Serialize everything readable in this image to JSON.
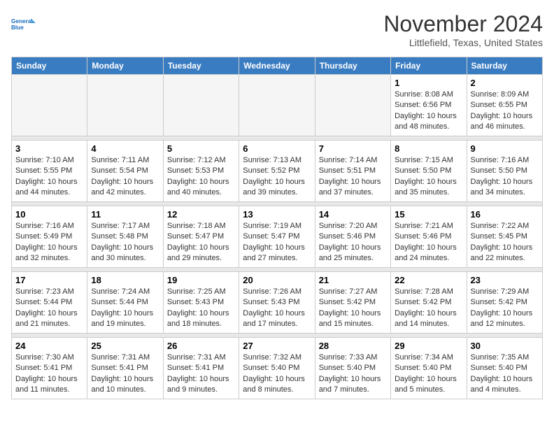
{
  "header": {
    "logo_line1": "General",
    "logo_line2": "Blue",
    "month": "November 2024",
    "location": "Littlefield, Texas, United States"
  },
  "days_of_week": [
    "Sunday",
    "Monday",
    "Tuesday",
    "Wednesday",
    "Thursday",
    "Friday",
    "Saturday"
  ],
  "weeks": [
    [
      {
        "day": "",
        "empty": true
      },
      {
        "day": "",
        "empty": true
      },
      {
        "day": "",
        "empty": true
      },
      {
        "day": "",
        "empty": true
      },
      {
        "day": "",
        "empty": true
      },
      {
        "day": "1",
        "sunrise": "8:08 AM",
        "sunset": "6:56 PM",
        "daylight": "10 hours and 48 minutes."
      },
      {
        "day": "2",
        "sunrise": "8:09 AM",
        "sunset": "6:55 PM",
        "daylight": "10 hours and 46 minutes."
      }
    ],
    [
      {
        "day": "3",
        "sunrise": "7:10 AM",
        "sunset": "5:55 PM",
        "daylight": "10 hours and 44 minutes."
      },
      {
        "day": "4",
        "sunrise": "7:11 AM",
        "sunset": "5:54 PM",
        "daylight": "10 hours and 42 minutes."
      },
      {
        "day": "5",
        "sunrise": "7:12 AM",
        "sunset": "5:53 PM",
        "daylight": "10 hours and 40 minutes."
      },
      {
        "day": "6",
        "sunrise": "7:13 AM",
        "sunset": "5:52 PM",
        "daylight": "10 hours and 39 minutes."
      },
      {
        "day": "7",
        "sunrise": "7:14 AM",
        "sunset": "5:51 PM",
        "daylight": "10 hours and 37 minutes."
      },
      {
        "day": "8",
        "sunrise": "7:15 AM",
        "sunset": "5:50 PM",
        "daylight": "10 hours and 35 minutes."
      },
      {
        "day": "9",
        "sunrise": "7:16 AM",
        "sunset": "5:50 PM",
        "daylight": "10 hours and 34 minutes."
      }
    ],
    [
      {
        "day": "10",
        "sunrise": "7:16 AM",
        "sunset": "5:49 PM",
        "daylight": "10 hours and 32 minutes."
      },
      {
        "day": "11",
        "sunrise": "7:17 AM",
        "sunset": "5:48 PM",
        "daylight": "10 hours and 30 minutes."
      },
      {
        "day": "12",
        "sunrise": "7:18 AM",
        "sunset": "5:47 PM",
        "daylight": "10 hours and 29 minutes."
      },
      {
        "day": "13",
        "sunrise": "7:19 AM",
        "sunset": "5:47 PM",
        "daylight": "10 hours and 27 minutes."
      },
      {
        "day": "14",
        "sunrise": "7:20 AM",
        "sunset": "5:46 PM",
        "daylight": "10 hours and 25 minutes."
      },
      {
        "day": "15",
        "sunrise": "7:21 AM",
        "sunset": "5:46 PM",
        "daylight": "10 hours and 24 minutes."
      },
      {
        "day": "16",
        "sunrise": "7:22 AM",
        "sunset": "5:45 PM",
        "daylight": "10 hours and 22 minutes."
      }
    ],
    [
      {
        "day": "17",
        "sunrise": "7:23 AM",
        "sunset": "5:44 PM",
        "daylight": "10 hours and 21 minutes."
      },
      {
        "day": "18",
        "sunrise": "7:24 AM",
        "sunset": "5:44 PM",
        "daylight": "10 hours and 19 minutes."
      },
      {
        "day": "19",
        "sunrise": "7:25 AM",
        "sunset": "5:43 PM",
        "daylight": "10 hours and 18 minutes."
      },
      {
        "day": "20",
        "sunrise": "7:26 AM",
        "sunset": "5:43 PM",
        "daylight": "10 hours and 17 minutes."
      },
      {
        "day": "21",
        "sunrise": "7:27 AM",
        "sunset": "5:42 PM",
        "daylight": "10 hours and 15 minutes."
      },
      {
        "day": "22",
        "sunrise": "7:28 AM",
        "sunset": "5:42 PM",
        "daylight": "10 hours and 14 minutes."
      },
      {
        "day": "23",
        "sunrise": "7:29 AM",
        "sunset": "5:42 PM",
        "daylight": "10 hours and 12 minutes."
      }
    ],
    [
      {
        "day": "24",
        "sunrise": "7:30 AM",
        "sunset": "5:41 PM",
        "daylight": "10 hours and 11 minutes."
      },
      {
        "day": "25",
        "sunrise": "7:31 AM",
        "sunset": "5:41 PM",
        "daylight": "10 hours and 10 minutes."
      },
      {
        "day": "26",
        "sunrise": "7:31 AM",
        "sunset": "5:41 PM",
        "daylight": "10 hours and 9 minutes."
      },
      {
        "day": "27",
        "sunrise": "7:32 AM",
        "sunset": "5:40 PM",
        "daylight": "10 hours and 8 minutes."
      },
      {
        "day": "28",
        "sunrise": "7:33 AM",
        "sunset": "5:40 PM",
        "daylight": "10 hours and 7 minutes."
      },
      {
        "day": "29",
        "sunrise": "7:34 AM",
        "sunset": "5:40 PM",
        "daylight": "10 hours and 5 minutes."
      },
      {
        "day": "30",
        "sunrise": "7:35 AM",
        "sunset": "5:40 PM",
        "daylight": "10 hours and 4 minutes."
      }
    ]
  ]
}
